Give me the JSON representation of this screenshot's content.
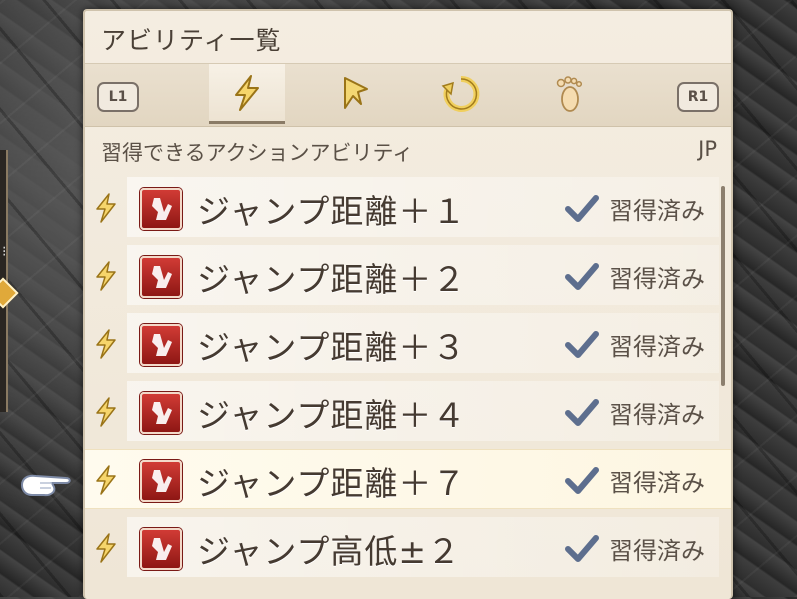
{
  "window": {
    "title": "アビリティ一覧"
  },
  "tabs": {
    "left_shoulder": "L1",
    "right_shoulder": "R1",
    "items": [
      {
        "icon": "action-ability-icon",
        "active": true
      },
      {
        "icon": "reaction-ability-icon",
        "active": false
      },
      {
        "icon": "support-ability-icon",
        "active": false
      },
      {
        "icon": "movement-ability-icon",
        "active": false
      }
    ]
  },
  "list_header": {
    "label": "習得できるアクションアビリティ",
    "cost_label": "JP"
  },
  "abilities": [
    {
      "name": "ジャンプ距離＋１",
      "status": "習得済み"
    },
    {
      "name": "ジャンプ距離＋２",
      "status": "習得済み"
    },
    {
      "name": "ジャンプ距離＋３",
      "status": "習得済み"
    },
    {
      "name": "ジャンプ距離＋４",
      "status": "習得済み"
    },
    {
      "name": "ジャンプ距離＋７",
      "status": "習得済み",
      "selected": true
    },
    {
      "name": "ジャンプ高低±２",
      "status": "習得済み"
    }
  ],
  "colors": {
    "accent": "#5d6e8e",
    "icon_red": "#b3221e",
    "panel_bg": "#f2eadc"
  }
}
